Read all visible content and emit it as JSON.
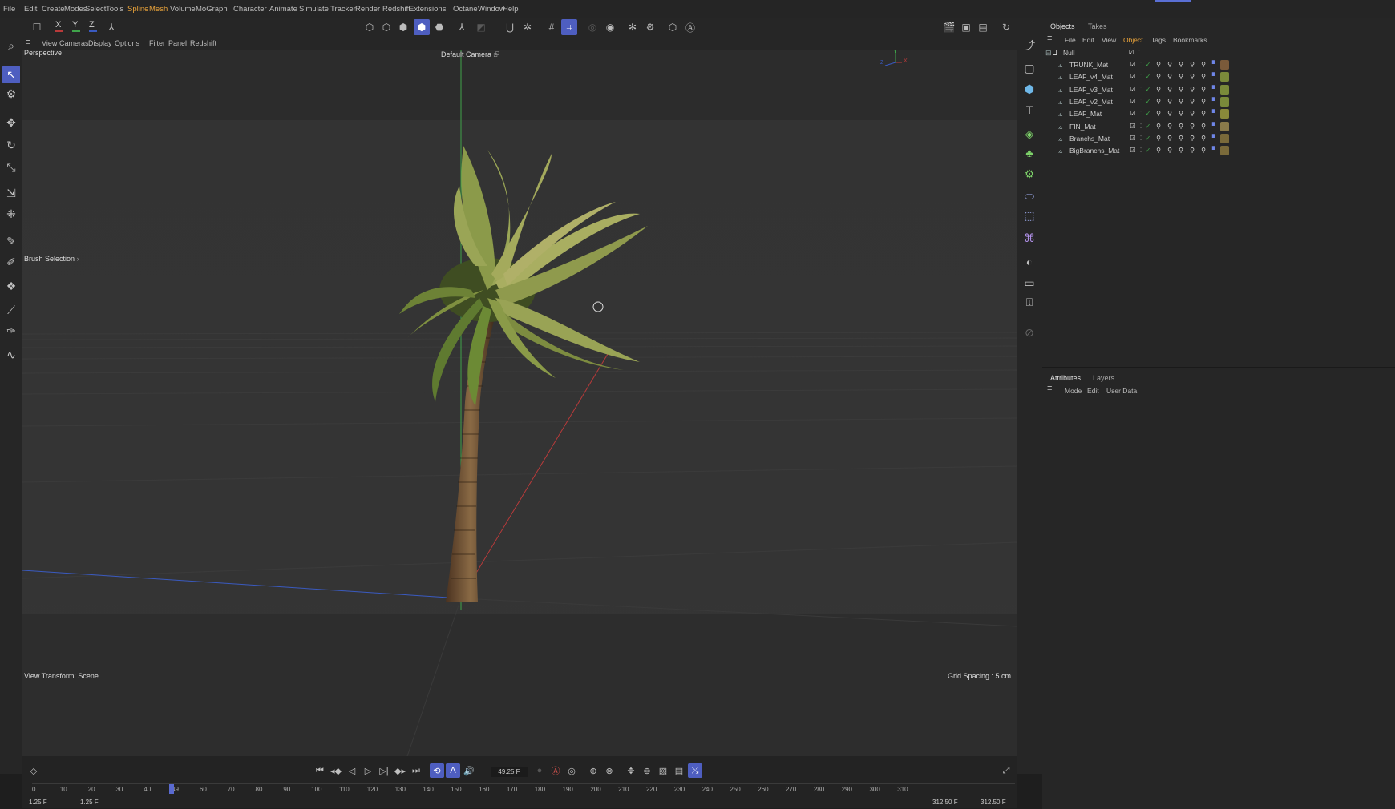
{
  "menu": [
    "File",
    "Edit",
    "Create",
    "Modes",
    "Select",
    "Tools",
    "Spline",
    "Mesh",
    "Volume",
    "MoGraph",
    "Character",
    "Animate",
    "Simulate",
    "Tracker",
    "Render",
    "Redshift",
    "Extensions",
    "Octane",
    "Window",
    "Help"
  ],
  "toolbar": {
    "axis_x": "X",
    "axis_y": "Y",
    "axis_z": "Z"
  },
  "viewport_menu": [
    "View",
    "Cameras",
    "Display",
    "Options",
    "Filter",
    "Panel",
    "Redshift"
  ],
  "viewport": {
    "name": "Perspective",
    "camera": "Default Camera",
    "camera_icon": "⮺",
    "brush_selection": "Brush Selection",
    "brush_arrow": "›",
    "view_transform": "View Transform: Scene",
    "grid_spacing": "Grid Spacing : 5 cm",
    "gizmo_y": "Y",
    "gizmo_x": "X",
    "gizmo_z": "Z"
  },
  "objects_panel": {
    "tabs": [
      "Objects",
      "Takes"
    ],
    "menu": [
      "File",
      "Edit",
      "View",
      "Object",
      "Tags",
      "Bookmarks"
    ],
    "root": "Null",
    "items": [
      {
        "name": "TRUNK_Mat",
        "mat": "#7a5a3a"
      },
      {
        "name": "LEAF_v4_Mat",
        "mat": "#7a8a3a"
      },
      {
        "name": "LEAF_v3_Mat",
        "mat": "#7a8a3a"
      },
      {
        "name": "LEAF_v2_Mat",
        "mat": "#7a8a3a"
      },
      {
        "name": "LEAF_Mat",
        "mat": "#8a8a3a"
      },
      {
        "name": "FIN_Mat",
        "mat": "#8a7a4a"
      },
      {
        "name": "Branchs_Mat",
        "mat": "#7a6a3a"
      },
      {
        "name": "BigBranchs_Mat",
        "mat": "#7a6a3a"
      }
    ]
  },
  "attributes_panel": {
    "tabs": [
      "Attributes",
      "Layers"
    ],
    "menu": [
      "Mode",
      "Edit",
      "User Data"
    ]
  },
  "timeline": {
    "current_frame": "49.25 F",
    "start_a": "1.25 F",
    "start_b": "1.25 F",
    "end_a": "312.50 F",
    "end_b": "312.50 F",
    "ticks": [
      "0",
      "10",
      "20",
      "30",
      "40",
      "49",
      "60",
      "70",
      "80",
      "90",
      "100",
      "110",
      "120",
      "130",
      "140",
      "150",
      "160",
      "170",
      "180",
      "190",
      "200",
      "210",
      "220",
      "230",
      "240",
      "250",
      "260",
      "270",
      "280",
      "290",
      "300",
      "310"
    ],
    "playhead_frame": 49.25,
    "max_frame": 312.5
  },
  "colors": {
    "accent": "#4e5ec0",
    "highlight_text": "#e8a23a",
    "y_axis": "#3fa34a",
    "x_axis": "#b83a3a",
    "z_axis": "#3a5ac0"
  }
}
